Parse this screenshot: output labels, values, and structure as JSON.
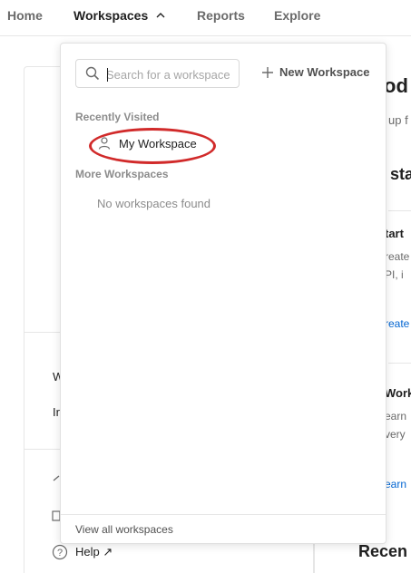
{
  "nav": {
    "home": "Home",
    "workspaces": "Workspaces",
    "reports": "Reports",
    "explore": "Explore"
  },
  "dropdown": {
    "search_placeholder": "Search for a workspace",
    "new_workspace": "New Workspace",
    "recently_visited_label": "Recently Visited",
    "recent_items": [
      {
        "label": "My Workspace",
        "icon": "person-icon"
      }
    ],
    "more_workspaces_label": "More Workspaces",
    "empty_text": "No workspaces found",
    "view_all": "View all workspaces"
  },
  "background": {
    "right_fragments": [
      "od",
      "up f",
      "sta",
      "tart",
      "reate",
      "PI, i",
      "reate",
      "Work",
      "earn",
      "very",
      "earn",
      "Recen"
    ],
    "left_fragments": [
      "W",
      "Ir"
    ],
    "help": "Help ↗"
  },
  "colors": {
    "highlight": "#d12a2a",
    "link": "#0265d2"
  }
}
